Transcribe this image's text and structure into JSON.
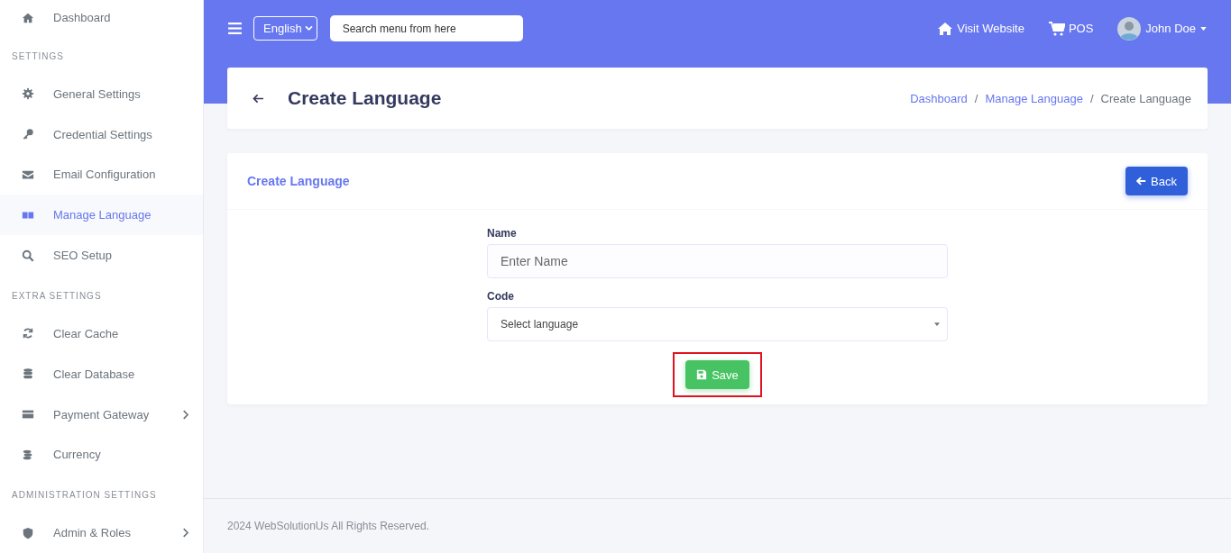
{
  "sidebar": {
    "items": [
      {
        "kind": "link",
        "label": "Dashboard",
        "selected": false,
        "has_submenu": false
      },
      {
        "kind": "section",
        "label": "SETTINGS"
      },
      {
        "kind": "link",
        "label": "General Settings",
        "selected": false,
        "has_submenu": false
      },
      {
        "kind": "link",
        "label": "Credential Settings",
        "selected": false,
        "has_submenu": false
      },
      {
        "kind": "link",
        "label": "Email Configuration",
        "selected": false,
        "has_submenu": false
      },
      {
        "kind": "link",
        "label": "Manage Language",
        "selected": true,
        "has_submenu": false
      },
      {
        "kind": "link",
        "label": "SEO Setup",
        "selected": false,
        "has_submenu": false
      },
      {
        "kind": "section",
        "label": "EXTRA SETTINGS"
      },
      {
        "kind": "link",
        "label": "Clear Cache",
        "selected": false,
        "has_submenu": false
      },
      {
        "kind": "link",
        "label": "Clear Database",
        "selected": false,
        "has_submenu": false
      },
      {
        "kind": "link",
        "label": "Payment Gateway",
        "selected": false,
        "has_submenu": true
      },
      {
        "kind": "link",
        "label": "Currency",
        "selected": false,
        "has_submenu": false
      },
      {
        "kind": "section",
        "label": "ADMINISTRATION SETTINGS"
      },
      {
        "kind": "link",
        "label": "Admin & Roles",
        "selected": false,
        "has_submenu": true
      }
    ]
  },
  "navbar": {
    "language": "English",
    "search": {
      "placeholder": "Search menu from here"
    },
    "visit_website": "Visit Website",
    "pos": "POS",
    "user": "John Doe"
  },
  "page_header": {
    "title": "Create Language",
    "breadcrumb": [
      {
        "label": "Dashboard",
        "link": true
      },
      {
        "separator": "/",
        "label": "Manage Language",
        "link": true
      },
      {
        "separator": "/",
        "label": "Create Language",
        "link": false
      }
    ]
  },
  "form_card": {
    "title": "Create Language",
    "back_button": "Back",
    "fields": [
      {
        "kind": "text",
        "label": "Name",
        "placeholder": "Enter Name"
      },
      {
        "kind": "select",
        "label": "Code",
        "value": "Select language"
      }
    ],
    "save_button": {
      "label": "Save",
      "highlighted": true
    }
  },
  "footer": {
    "text": "2024 WebSolutionUs All Rights Reserved."
  }
}
